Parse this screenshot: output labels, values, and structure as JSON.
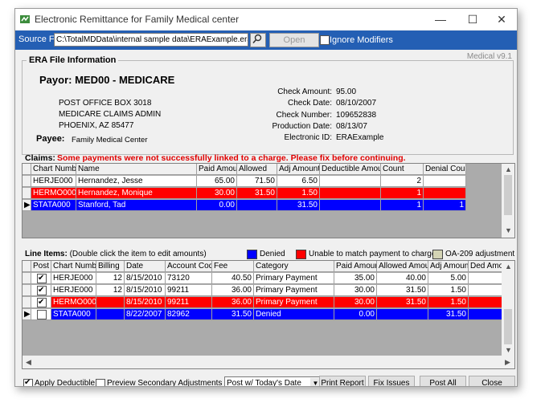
{
  "window": {
    "title": "Electronic Remittance for Family Medical center",
    "minimize": "—",
    "maximize": "☐",
    "close": "✕"
  },
  "source": {
    "label": "Source File:",
    "path": "C:\\TotalMDData\\internal sample data\\ERAExample.era",
    "open_label": "Open",
    "ignore_label": "Ignore Modifiers",
    "ignore_checked": false
  },
  "version": "Medical v9.1",
  "era": {
    "legend": "ERA File Information",
    "payor": "Payor:  MED00 - MEDICARE",
    "address": [
      "POST OFFICE BOX 3018",
      "MEDICARE CLAIMS ADMIN",
      "PHOENIX, AZ  85477"
    ],
    "payee_label": "Payee:",
    "payee_value": "Family Medical Center",
    "fields": [
      {
        "k": "Check Amount:",
        "v": "95.00"
      },
      {
        "k": "Check Date:",
        "v": "08/10/2007"
      },
      {
        "k": "Check Number:",
        "v": "109652838"
      },
      {
        "k": "Production Date:",
        "v": "08/13/07"
      },
      {
        "k": "Electronic ID:",
        "v": "ERAExample"
      }
    ]
  },
  "claims": {
    "title": "Claims:",
    "warning": "Some payments were not successfully linked to a charge.  Please fix before continuing.",
    "headers": [
      "",
      "Chart Number",
      "Name",
      "Paid Amount",
      "Allowed",
      "Adj Amount",
      "Deductible Amount",
      "Count",
      "Denial Count"
    ],
    "rows": [
      {
        "marker": "",
        "chart": "HERJE000",
        "name": "Hernandez, Jesse",
        "paid": "65.00",
        "allowed": "71.50",
        "adj": "6.50",
        "deductible": "",
        "count": "2",
        "denial": "",
        "style": "normal"
      },
      {
        "marker": "",
        "chart": "HERMO000",
        "name": "Hernandez, Monique",
        "paid": "30.00",
        "allowed": "31.50",
        "adj": "1.50",
        "deductible": "",
        "count": "1",
        "denial": "",
        "style": "red"
      },
      {
        "marker": "▶",
        "chart": "STATA000",
        "name": "Stanford, Tad",
        "paid": "0.00",
        "allowed": "",
        "adj": "31.50",
        "deductible": "",
        "count": "1",
        "denial": "1",
        "style": "blue"
      }
    ]
  },
  "lineitems": {
    "title": "Line Items:",
    "subtitle": "(Double click the item to edit amounts)",
    "legend": [
      {
        "label": "Denied",
        "color": "#0000ff"
      },
      {
        "label": "Unable to match payment to charge",
        "color": "#ff0000"
      },
      {
        "label": "OA-209 adjustment",
        "color": "#d4d4b4"
      }
    ],
    "headers": [
      "",
      "Post",
      "Chart Number",
      "Billing",
      "Date",
      "Account Code",
      "Fee",
      "Category",
      "Paid Amount",
      "Allowed Amount",
      "Adj Amount",
      "Ded Amou"
    ],
    "rows": [
      {
        "marker": "",
        "post": true,
        "chart": "HERJE000",
        "billing": "12",
        "date": "8/15/2010",
        "code": "73120",
        "fee": "40.50",
        "category": "Primary Payment",
        "paid": "35.00",
        "allowed": "40.00",
        "adj": "5.00",
        "ded": "",
        "style": "normal"
      },
      {
        "marker": "",
        "post": true,
        "chart": "HERJE000",
        "billing": "12",
        "date": "8/15/2010",
        "code": "99211",
        "fee": "36.00",
        "category": "Primary Payment",
        "paid": "30.00",
        "allowed": "31.50",
        "adj": "1.50",
        "ded": "",
        "style": "normal"
      },
      {
        "marker": "",
        "post": true,
        "chart": "HERMO000",
        "billing": "",
        "date": "8/15/2010",
        "code": "99211",
        "fee": "36.00",
        "category": "Primary Payment",
        "paid": "30.00",
        "allowed": "31.50",
        "adj": "1.50",
        "ded": "",
        "style": "red"
      },
      {
        "marker": "▶",
        "post": false,
        "chart": "STATA000",
        "billing": "",
        "date": "8/22/2007",
        "code": "82962",
        "fee": "31.50",
        "category": "Denied",
        "paid": "0.00",
        "allowed": "",
        "adj": "31.50",
        "ded": "",
        "style": "blue"
      }
    ]
  },
  "bottom": {
    "apply_deductible": "Apply Deductible",
    "apply_deductible_checked": true,
    "preview_secondary": "Preview Secondary Adjustments",
    "preview_secondary_checked": false,
    "post_option": "Post w/ Today's Date",
    "buttons": {
      "print": "Print Report",
      "fix": "Fix Issues",
      "post_all": "Post All",
      "close": "Close"
    }
  },
  "colors": {
    "blue_row": "#0000ff",
    "red_row": "#ff0000",
    "title_bar": "#245fb4"
  }
}
